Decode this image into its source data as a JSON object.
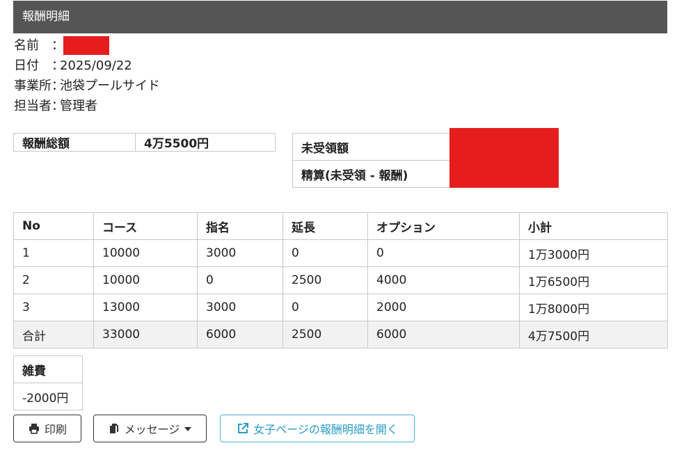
{
  "header": {
    "title": "報酬明細"
  },
  "info": {
    "name_label": "名前　：",
    "name_value": "",
    "date_label": "日付　：",
    "date_value": "2025/09/22",
    "office_label": "事業所：",
    "office_value": "池袋プールサイド",
    "staff_label": "担当者：",
    "staff_value": "管理者"
  },
  "summary": {
    "total_label": "報酬総額",
    "total_value": "4万5500円",
    "unpaid_label": "未受領額",
    "settle_label": "精算(未受領 - 報酬)"
  },
  "table": {
    "headers": [
      "No",
      "コース",
      "指名",
      "延長",
      "オプション",
      "小計"
    ],
    "rows": [
      [
        "1",
        "10000",
        "3000",
        "0",
        "0",
        "1万3000円"
      ],
      [
        "2",
        "10000",
        "0",
        "2500",
        "4000",
        "1万6500円"
      ],
      [
        "3",
        "13000",
        "3000",
        "0",
        "2000",
        "1万8000円"
      ]
    ],
    "total_row": [
      "合計",
      "33000",
      "6000",
      "2500",
      "6000",
      "4万7500円"
    ]
  },
  "misc": {
    "label": "雑費",
    "value": "-2000円"
  },
  "buttons": {
    "print": "印刷",
    "message": "メッセージ",
    "open_page": "女子ページの報酬明細を開く"
  },
  "colors": {
    "header_bg": "#555555",
    "redaction": "#e61d1d",
    "link_accent": "#2a9cc8"
  }
}
